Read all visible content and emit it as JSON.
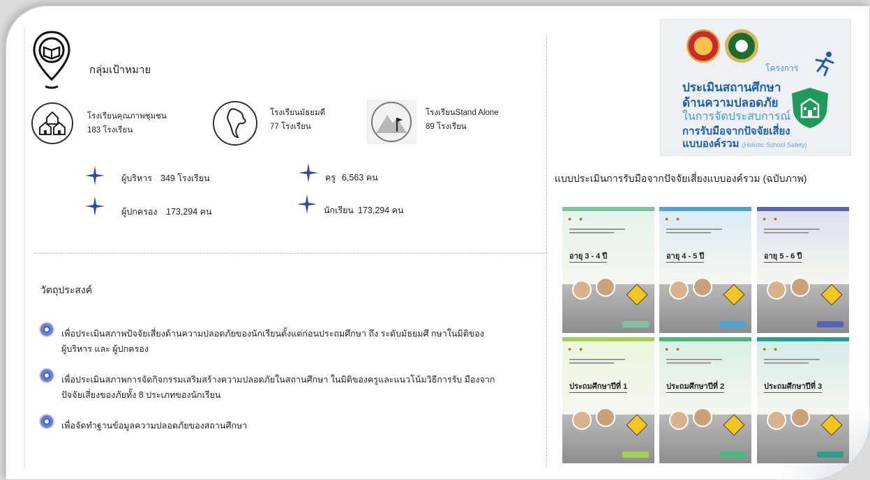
{
  "target_group": {
    "title": "กลุ่มเป้าหมาย",
    "schools": [
      {
        "name": "โรงเรียนคุณภาพชุมชน",
        "count": "183 โรงเรียน",
        "icon": "houses-icon"
      },
      {
        "name": "โรงเรียนมัธยมดี",
        "count": "77 โรงเรียน",
        "icon": "thailand-map-icon"
      },
      {
        "name": "โรงเรียนStand Alone",
        "count": "89 โรงเรียน",
        "icon": "mountain-flag-icon"
      }
    ],
    "stats": [
      {
        "label": "ผู้บริหาร",
        "value": "349 โรงเรียน"
      },
      {
        "label": "ครู",
        "value": "6,563 คน"
      },
      {
        "label": "ผู้ปกครอง",
        "value": "173,294 คน"
      },
      {
        "label": "นักเรียน",
        "value": "173,294 คน"
      }
    ]
  },
  "objectives": {
    "title": "วัตถุประสงค์",
    "items": [
      {
        "line1": "เพื่อประเมินสภาพปัจจัยเสี่ยงด้านความปลอดภัยของนักเรียนตั้งแต่ก่อนประถมศึกษา ถึง ระดับมัธยมศึ     กษาในมิติของ",
        "line2": "ผู้บริหาร และ ผู้ปกครอง"
      },
      {
        "line1": "เพื่อประเมินสภาพการจัดกิจกรรมเสริมสร้างความปลอดภัยในสถานศึกษา ในมิติของครูและแนวโน้มวิธีการรับ        มืองจาก",
        "line2": "ปัจจัยเสี่ยงของภัยทั้ง  8 ประเภทของนักเรียน"
      },
      {
        "line1": "เพื่อจัดทำฐานข้อมูลความปลอดภัยของสถานศึกษา",
        "line2": ""
      }
    ]
  },
  "project_logo": {
    "project_label": "โครงการ",
    "line1": "ประเมินสถานศึกษา",
    "line2": "ด้านความปลอดภัย",
    "line3": "ในการจัดประสบการณ์",
    "line4": "การรับมือจากปัจจัยเสี่ยง",
    "line5": "แบบองค์รวม",
    "line5_en": "(Holistic School Safety)",
    "colors": {
      "primary": "#1f5fa9",
      "secondary": "#3c9ad6",
      "shield": "#1e9a5b"
    }
  },
  "assessment": {
    "title": "แบบประเมินการรับมือจากปัจจัยเสี่ยงแบบองค์รวม (ฉบับภาพ)",
    "covers": [
      {
        "level": "อายุ 3 - 4 ปี",
        "accent": "#7fc3a0"
      },
      {
        "level": "อายุ 4 - 5 ปี",
        "accent": "#4ea3d6"
      },
      {
        "level": "อายุ 5 - 6 ปี",
        "accent": "#5b63b5"
      },
      {
        "level": "ประถมศึกษาปีที่ 1",
        "accent": "#a5cf57"
      },
      {
        "level": "ประถมศึกษาปีที่ 2",
        "accent": "#4fb67d"
      },
      {
        "level": "ประถมศึกษาปีที่ 3",
        "accent": "#2e9c8e"
      }
    ]
  }
}
